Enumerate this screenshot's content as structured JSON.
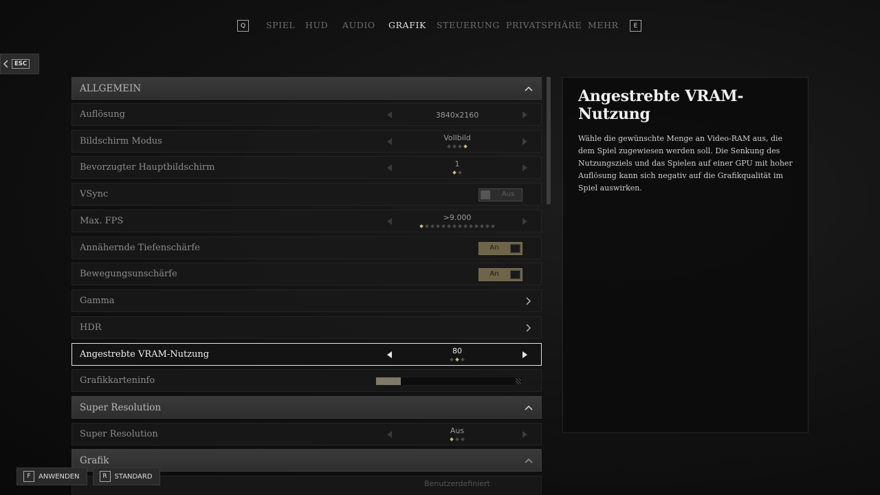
{
  "nav": {
    "prev_key": "Q",
    "next_key": "E",
    "tabs": [
      {
        "label": "SPIEL",
        "active": false
      },
      {
        "label": "HUD",
        "active": false
      },
      {
        "label": "AUDIO",
        "active": false
      },
      {
        "label": "GRAFIK",
        "active": true
      },
      {
        "label": "STEUERUNG",
        "active": false
      },
      {
        "label": "PRIVATSPHÄRE",
        "active": false
      },
      {
        "label": "MEHR",
        "active": false
      }
    ]
  },
  "back": {
    "key": "ESC"
  },
  "settings": {
    "section_allgemein": "ALLGEMEIN",
    "aufloesung": {
      "label": "Auflösung",
      "value": "3840x2160"
    },
    "bildschirm_modus": {
      "label": "Bildschirm Modus",
      "value": "Vollbild",
      "pips": 4,
      "selected_pip": 3
    },
    "hauptbildschirm": {
      "label": "Bevorzugter Hauptbildschirm",
      "value": "1",
      "pips": 2,
      "selected_pip": 0
    },
    "vsync": {
      "label": "VSync",
      "value": "Aus"
    },
    "max_fps": {
      "label": "Max. FPS",
      "value": ">9.000",
      "pips": 14,
      "selected_pip": 0
    },
    "tiefenschaerfe": {
      "label": "Annähernde Tiefenschärfe",
      "value": "An"
    },
    "bewegungsunschaerfe": {
      "label": "Bewegungsunschärfe",
      "value": "An"
    },
    "gamma": {
      "label": "Gamma"
    },
    "hdr": {
      "label": "HDR"
    },
    "vram": {
      "label": "Angestrebte VRAM-Nutzung",
      "value": "80",
      "pips": 3,
      "selected_pip": 1
    },
    "grafikkarteninfo": {
      "label": "Grafikkarteninfo",
      "usage_fraction": 0.17
    },
    "section_super_resolution": "Super Resolution",
    "super_resolution": {
      "label": "Super Resolution",
      "value": "Aus",
      "pips": 3,
      "selected_pip": 0
    },
    "section_grafik": "Grafik",
    "partial_value": "Benutzerdefiniert"
  },
  "description": {
    "title": "Angestrebte VRAM-Nutzung",
    "text": "Wähle die gewünschte Menge an Video-RAM aus, die dem Spiel zugewiesen werden soll. Die Senkung des Nutzungsziels und das Spielen auf einer GPU mit hoher Auflösung kann sich negativ auf die Grafikqualität im Spiel auswirken."
  },
  "bottom": {
    "apply_key": "F",
    "apply_label": "ANWENDEN",
    "default_key": "R",
    "default_label": "STANDARD"
  },
  "colors": {
    "accent": "#c9b779",
    "toggle_on": "#6e6548",
    "selected_border": "#e6e6e6"
  }
}
